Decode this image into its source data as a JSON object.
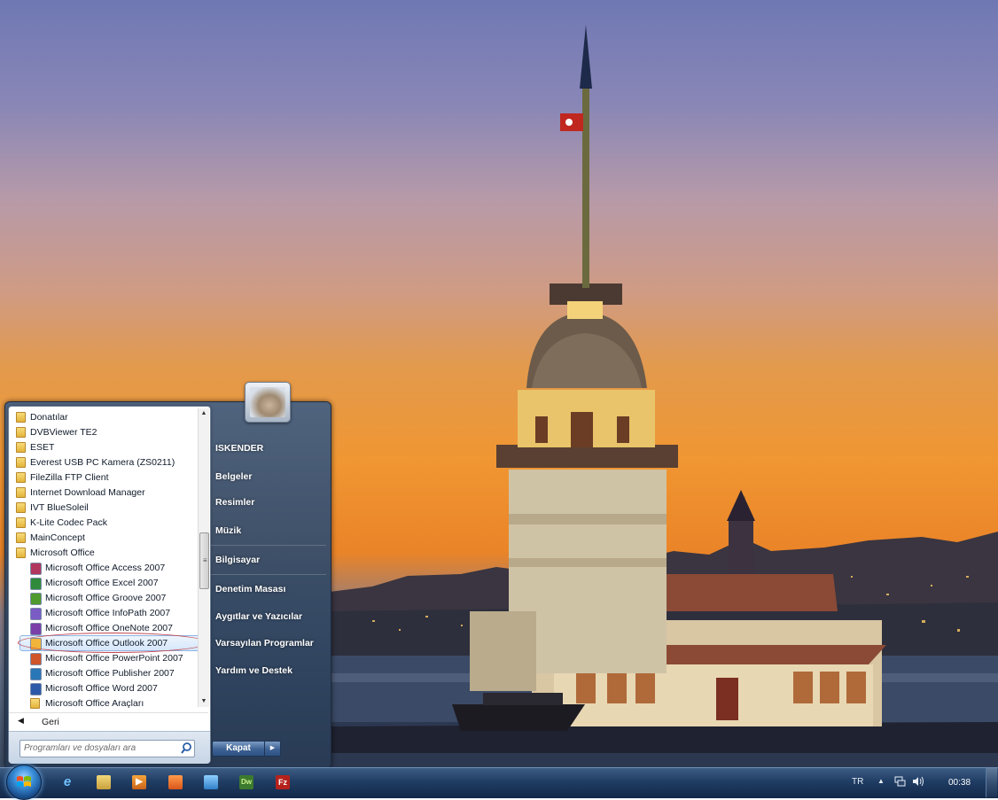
{
  "start_menu": {
    "programs": [
      {
        "label": "Donatılar",
        "kind": "folder"
      },
      {
        "label": "DVBViewer TE2",
        "kind": "folder"
      },
      {
        "label": "ESET",
        "kind": "folder"
      },
      {
        "label": "Everest USB PC Kamera (ZS0211)",
        "kind": "folder"
      },
      {
        "label": "FileZilla FTP Client",
        "kind": "folder"
      },
      {
        "label": "Internet Download Manager",
        "kind": "folder"
      },
      {
        "label": "IVT BlueSoleil",
        "kind": "folder"
      },
      {
        "label": "K-Lite Codec Pack",
        "kind": "folder"
      },
      {
        "label": "MainConcept",
        "kind": "folder"
      },
      {
        "label": "Microsoft Office",
        "kind": "folder"
      },
      {
        "label": "Microsoft Office Access 2007",
        "kind": "app"
      },
      {
        "label": "Microsoft Office Excel 2007",
        "kind": "app"
      },
      {
        "label": "Microsoft Office Groove 2007",
        "kind": "app"
      },
      {
        "label": "Microsoft Office InfoPath 2007",
        "kind": "app"
      },
      {
        "label": "Microsoft Office OneNote 2007",
        "kind": "app"
      },
      {
        "label": "Microsoft Office Outlook 2007",
        "kind": "app",
        "selected": true
      },
      {
        "label": "Microsoft Office PowerPoint 2007",
        "kind": "app"
      },
      {
        "label": "Microsoft Office Publisher 2007",
        "kind": "app"
      },
      {
        "label": "Microsoft Office Word 2007",
        "kind": "app"
      },
      {
        "label": "Microsoft Office Araçları",
        "kind": "subfolder"
      }
    ],
    "back_label": "Geri",
    "search_placeholder": "Programları ve dosyaları ara",
    "right_items": [
      "ISKENDER",
      "Belgeler",
      "Resimler",
      "Müzik",
      "Bilgisayar",
      "Denetim Masası",
      "Aygıtlar ve Yazıcılar",
      "Varsayılan Programlar",
      "Yardım ve Destek"
    ],
    "shutdown_label": "Kapat"
  },
  "taskbar": {
    "pinned": [
      "internet-explorer",
      "windows-explorer",
      "media-player",
      "rss-app",
      "contacts-app",
      "dreamweaver",
      "filezilla"
    ],
    "dreamweaver_label": "Dw",
    "filezilla_label": "Fz",
    "language": "TR",
    "time": "00:38"
  },
  "colors": {
    "menu_blue": "#3d5a80",
    "highlight_border": "#8eb6e6",
    "annotation_red": "#c2444c",
    "sunset_orange": "#f09632"
  }
}
